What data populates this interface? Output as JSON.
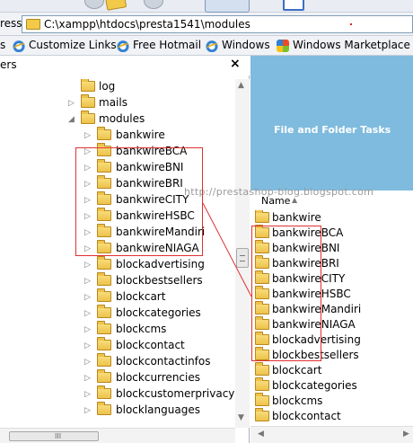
{
  "address": {
    "label": "ress",
    "path": "C:\\xampp\\htdocs\\presta1541\\modules"
  },
  "links": [
    {
      "label": "s",
      "icon": "none"
    },
    {
      "label": "Customize Links",
      "icon": "ie-icon"
    },
    {
      "label": "Free Hotmail",
      "icon": "ie-icon"
    },
    {
      "label": "Windows",
      "icon": "ie-icon"
    },
    {
      "label": "Windows Marketplace",
      "icon": "windows-logo-icon"
    }
  ],
  "folders_pane": {
    "title": "ers",
    "close": "×"
  },
  "tree": [
    {
      "label": "log",
      "expander": ""
    },
    {
      "label": "mails",
      "expander": "▷"
    },
    {
      "label": "modules",
      "expander": "◢"
    },
    {
      "label": "bankwire",
      "expander": "▷"
    },
    {
      "label": "bankwireBCA",
      "expander": "▷"
    },
    {
      "label": "bankwireBNI",
      "expander": "▷"
    },
    {
      "label": "bankwireBRI",
      "expander": "▷"
    },
    {
      "label": "bankwireCITY",
      "expander": "▷"
    },
    {
      "label": "bankwireHSBC",
      "expander": "▷"
    },
    {
      "label": "bankwireMandiri",
      "expander": "▷"
    },
    {
      "label": "bankwireNIAGA",
      "expander": "▷"
    },
    {
      "label": "blockadvertising",
      "expander": "▷"
    },
    {
      "label": "blockbestsellers",
      "expander": "▷"
    },
    {
      "label": "blockcart",
      "expander": "▷"
    },
    {
      "label": "blockcategories",
      "expander": "▷"
    },
    {
      "label": "blockcms",
      "expander": "▷"
    },
    {
      "label": "blockcontact",
      "expander": "▷"
    },
    {
      "label": "blockcontactinfos",
      "expander": "▷"
    },
    {
      "label": "blockcurrencies",
      "expander": "▷"
    },
    {
      "label": "blockcustomerprivacy",
      "expander": "▷"
    },
    {
      "label": "blocklanguages",
      "expander": "▷"
    }
  ],
  "hscroll_grip": "III",
  "task_panel": {
    "title": "File and Folder Tasks"
  },
  "watermark": "http://prestashop-blog.blogspot.com",
  "file_list": {
    "column_name": "Name",
    "sort_arrow": "▲",
    "items": [
      "bankwire",
      "bankwireBCA",
      "bankwireBNI",
      "bankwireBRI",
      "bankwireCITY",
      "bankwireHSBC",
      "bankwireMandiri",
      "bankwireNIAGA",
      "blockadvertising",
      "blockbestsellers",
      "blockcart",
      "blockcategories",
      "blockcms",
      "blockcontact"
    ]
  },
  "colors": {
    "annotation": "#e03030",
    "task_panel": "#7fbbde",
    "folder": "#eec24a"
  }
}
